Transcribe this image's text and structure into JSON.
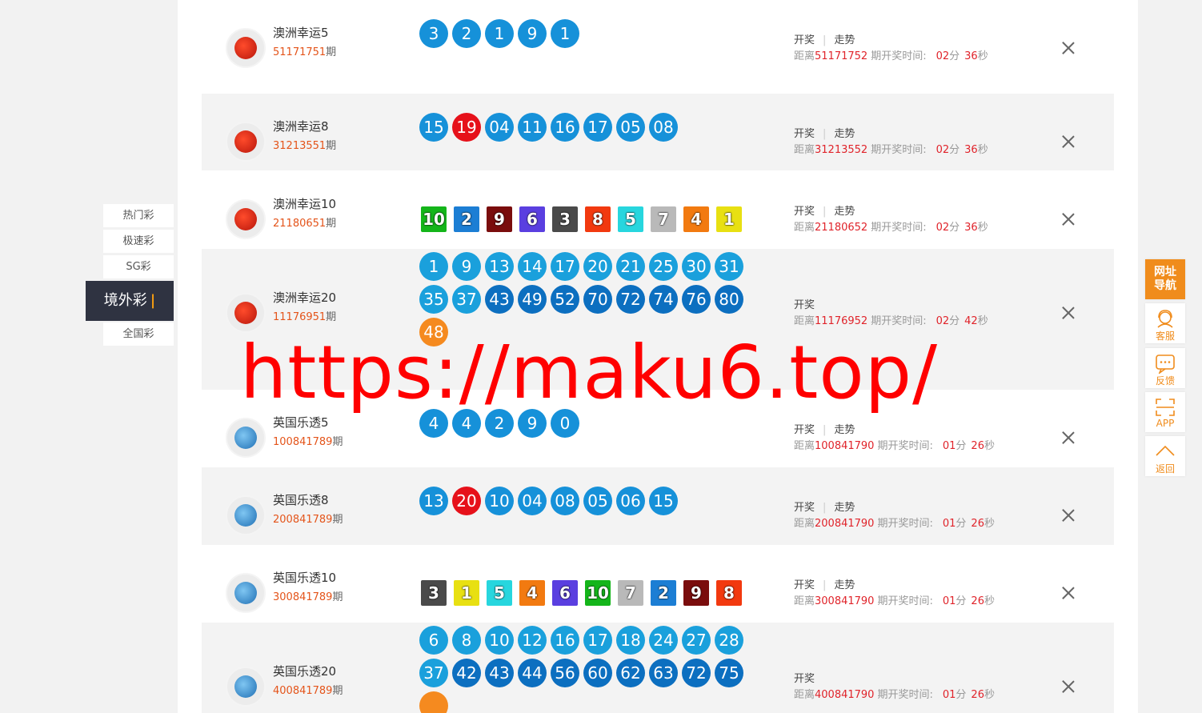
{
  "sidenav": {
    "tabs": [
      "热门彩",
      "极速彩",
      "SG彩"
    ],
    "active": "境外彩",
    "last": "全国彩"
  },
  "labels": {
    "draw": "开奖",
    "trend": "走势",
    "qi": "期",
    "distance": "距离",
    "next_draw_time": "期开奖时间:",
    "min": "分",
    "sec": "秒"
  },
  "colors": {
    "ball_blue": "#1691d9",
    "ball_dark": "#0c71c3",
    "ball_red": "#e6111a",
    "ball_orange": "#f58a1f",
    "accent": "#f08c1c",
    "nav_dark": "#2f3341"
  },
  "rows": [
    {
      "name": "澳洲幸运5",
      "issue": "51171751",
      "next": "51171752",
      "m": "02",
      "s": "36",
      "trend": true,
      "logo": "au",
      "type": "ball",
      "balls": [
        {
          "n": "3",
          "c": "#1691d9"
        },
        {
          "n": "2",
          "c": "#1691d9"
        },
        {
          "n": "1",
          "c": "#1691d9"
        },
        {
          "n": "9",
          "c": "#1691d9"
        },
        {
          "n": "1",
          "c": "#1691d9"
        }
      ]
    },
    {
      "name": "澳洲幸运8",
      "issue": "31213551",
      "next": "31213552",
      "m": "02",
      "s": "36",
      "trend": true,
      "logo": "au",
      "type": "ball",
      "balls": [
        {
          "n": "15",
          "c": "#1691d9"
        },
        {
          "n": "19",
          "c": "#e6111a"
        },
        {
          "n": "04",
          "c": "#1691d9"
        },
        {
          "n": "11",
          "c": "#1691d9"
        },
        {
          "n": "16",
          "c": "#1691d9"
        },
        {
          "n": "17",
          "c": "#1691d9"
        },
        {
          "n": "05",
          "c": "#1691d9"
        },
        {
          "n": "08",
          "c": "#1691d9"
        }
      ]
    },
    {
      "name": "澳洲幸运10",
      "issue": "21180651",
      "next": "21180652",
      "m": "02",
      "s": "36",
      "trend": true,
      "logo": "au",
      "type": "sq",
      "balls": [
        {
          "n": "10",
          "c": "#14b51a"
        },
        {
          "n": "2",
          "c": "#1c7ed4"
        },
        {
          "n": "9",
          "c": "#7a0d0d"
        },
        {
          "n": "6",
          "c": "#5a3fe0"
        },
        {
          "n": "3",
          "c": "#4a4a4a"
        },
        {
          "n": "8",
          "c": "#f2390f"
        },
        {
          "n": "5",
          "c": "#27d6de"
        },
        {
          "n": "7",
          "c": "#b9b9b9"
        },
        {
          "n": "4",
          "c": "#f27a10"
        },
        {
          "n": "1",
          "c": "#e8e012"
        }
      ]
    },
    {
      "name": "澳洲幸运20",
      "issue": "11176951",
      "next": "11176952",
      "m": "02",
      "s": "42",
      "trend": false,
      "logo": "au",
      "type": "ball",
      "balls": [
        {
          "n": "1",
          "c": "#1aa0dc"
        },
        {
          "n": "9",
          "c": "#1aa0dc"
        },
        {
          "n": "13",
          "c": "#1aa0dc"
        },
        {
          "n": "14",
          "c": "#1aa0dc"
        },
        {
          "n": "17",
          "c": "#1aa0dc"
        },
        {
          "n": "20",
          "c": "#1aa0dc"
        },
        {
          "n": "21",
          "c": "#1aa0dc"
        },
        {
          "n": "25",
          "c": "#1aa0dc"
        },
        {
          "n": "30",
          "c": "#1aa0dc"
        },
        {
          "n": "31",
          "c": "#1aa0dc"
        },
        {
          "n": "35",
          "c": "#1aa0dc"
        },
        {
          "n": "37",
          "c": "#1aa0dc"
        },
        {
          "n": "43",
          "c": "#0c6fc0"
        },
        {
          "n": "49",
          "c": "#0c6fc0"
        },
        {
          "n": "52",
          "c": "#0c6fc0"
        },
        {
          "n": "70",
          "c": "#0c6fc0"
        },
        {
          "n": "72",
          "c": "#0c6fc0"
        },
        {
          "n": "74",
          "c": "#0c6fc0"
        },
        {
          "n": "76",
          "c": "#0c6fc0"
        },
        {
          "n": "80",
          "c": "#0c6fc0"
        },
        {
          "n": "48",
          "c": "#f58a1f"
        }
      ]
    },
    {
      "name": "英国乐透5",
      "issue": "100841789",
      "next": "100841790",
      "m": "01",
      "s": "26",
      "trend": true,
      "logo": "uk",
      "type": "ball",
      "balls": [
        {
          "n": "4",
          "c": "#1691d9"
        },
        {
          "n": "4",
          "c": "#1691d9"
        },
        {
          "n": "2",
          "c": "#1691d9"
        },
        {
          "n": "9",
          "c": "#1691d9"
        },
        {
          "n": "0",
          "c": "#1691d9"
        }
      ]
    },
    {
      "name": "英国乐透8",
      "issue": "200841789",
      "next": "200841790",
      "m": "01",
      "s": "26",
      "trend": true,
      "logo": "uk",
      "type": "ball",
      "balls": [
        {
          "n": "13",
          "c": "#1691d9"
        },
        {
          "n": "20",
          "c": "#e6111a"
        },
        {
          "n": "10",
          "c": "#1691d9"
        },
        {
          "n": "04",
          "c": "#1691d9"
        },
        {
          "n": "08",
          "c": "#1691d9"
        },
        {
          "n": "05",
          "c": "#1691d9"
        },
        {
          "n": "06",
          "c": "#1691d9"
        },
        {
          "n": "15",
          "c": "#1691d9"
        }
      ]
    },
    {
      "name": "英国乐透10",
      "issue": "300841789",
      "next": "300841790",
      "m": "01",
      "s": "26",
      "trend": true,
      "logo": "uk",
      "type": "sq",
      "balls": [
        {
          "n": "3",
          "c": "#4a4a4a"
        },
        {
          "n": "1",
          "c": "#e8e012"
        },
        {
          "n": "5",
          "c": "#27d6de"
        },
        {
          "n": "4",
          "c": "#f27a10"
        },
        {
          "n": "6",
          "c": "#5a3fe0"
        },
        {
          "n": "10",
          "c": "#14b51a"
        },
        {
          "n": "7",
          "c": "#b9b9b9"
        },
        {
          "n": "2",
          "c": "#1c7ed4"
        },
        {
          "n": "9",
          "c": "#7a0d0d"
        },
        {
          "n": "8",
          "c": "#f2390f"
        }
      ]
    },
    {
      "name": "英国乐透20",
      "issue": "400841789",
      "next": "400841790",
      "m": "01",
      "s": "26",
      "trend": false,
      "logo": "uk",
      "type": "ball",
      "balls": [
        {
          "n": "6",
          "c": "#1aa0dc"
        },
        {
          "n": "8",
          "c": "#1aa0dc"
        },
        {
          "n": "10",
          "c": "#1aa0dc"
        },
        {
          "n": "12",
          "c": "#1aa0dc"
        },
        {
          "n": "16",
          "c": "#1aa0dc"
        },
        {
          "n": "17",
          "c": "#1aa0dc"
        },
        {
          "n": "18",
          "c": "#1aa0dc"
        },
        {
          "n": "24",
          "c": "#1aa0dc"
        },
        {
          "n": "27",
          "c": "#1aa0dc"
        },
        {
          "n": "28",
          "c": "#1aa0dc"
        },
        {
          "n": "37",
          "c": "#1aa0dc"
        },
        {
          "n": "42",
          "c": "#0c6fc0"
        },
        {
          "n": "43",
          "c": "#0c6fc0"
        },
        {
          "n": "44",
          "c": "#0c6fc0"
        },
        {
          "n": "56",
          "c": "#0c6fc0"
        },
        {
          "n": "60",
          "c": "#0c6fc0"
        },
        {
          "n": "62",
          "c": "#0c6fc0"
        },
        {
          "n": "63",
          "c": "#0c6fc0"
        },
        {
          "n": "72",
          "c": "#0c6fc0"
        },
        {
          "n": "75",
          "c": "#0c6fc0"
        },
        {
          "n": "",
          "c": "#f58a1f"
        }
      ]
    }
  ],
  "float": {
    "nav": "网址导航",
    "service": "客服",
    "feedback": "反馈",
    "app": "APP",
    "back": "返回"
  },
  "watermark": "https://maku6.top/"
}
